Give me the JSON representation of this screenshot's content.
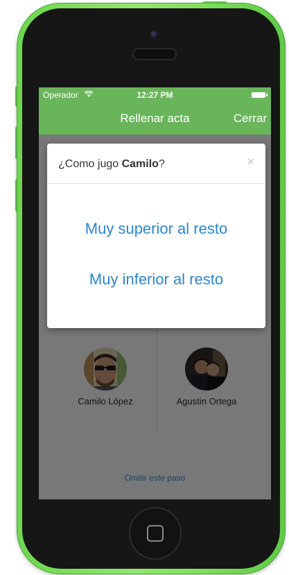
{
  "status_bar": {
    "carrier": "Operador",
    "time": "12:27 PM",
    "wifi_icon": "wifi-icon",
    "battery_icon": "battery-icon"
  },
  "nav": {
    "title": "Rellenar acta",
    "close_label": "Cerrar"
  },
  "modal": {
    "question_prefix": "¿Como jugo ",
    "player_name": "Camilo",
    "question_suffix": "?",
    "close_symbol": "×",
    "options": [
      "Muy superior al resto",
      "Muy inferior al resto"
    ]
  },
  "players": [
    {
      "name": "Camilo López"
    },
    {
      "name": "Agustin Ortega"
    }
  ],
  "skip_label": "Omitir este paso",
  "colors": {
    "accent_green": "#69b55a",
    "link_blue": "#2f86c7",
    "device_green": "#7de059"
  }
}
